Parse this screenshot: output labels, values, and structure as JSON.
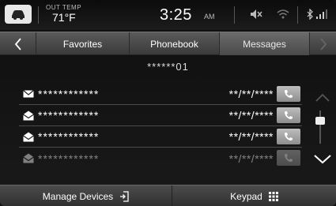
{
  "status": {
    "temp_label": "OUT TEMP",
    "temp_value": "71°F",
    "time": "3:25",
    "ampm": "AM",
    "icons": [
      "car-icon",
      "mute-icon",
      "wifi-icon",
      "bluetooth-icon",
      "signal-icon"
    ]
  },
  "tabs": {
    "favorites": "Favorites",
    "phonebook": "Phonebook",
    "messages": "Messages",
    "active": "messages"
  },
  "device_name": "******01",
  "messages": [
    {
      "icon": "envelope-closed-icon",
      "name": "************",
      "date": "**/**/****"
    },
    {
      "icon": "envelope-open-icon",
      "name": "************",
      "date": "**/**/****"
    },
    {
      "icon": "envelope-open-icon",
      "name": "************",
      "date": "**/**/****"
    },
    {
      "icon": "envelope-open-icon",
      "name": "************",
      "date": "**/**/****"
    }
  ],
  "bottom": {
    "manage_devices": "Manage Devices",
    "keypad": "Keypad"
  }
}
